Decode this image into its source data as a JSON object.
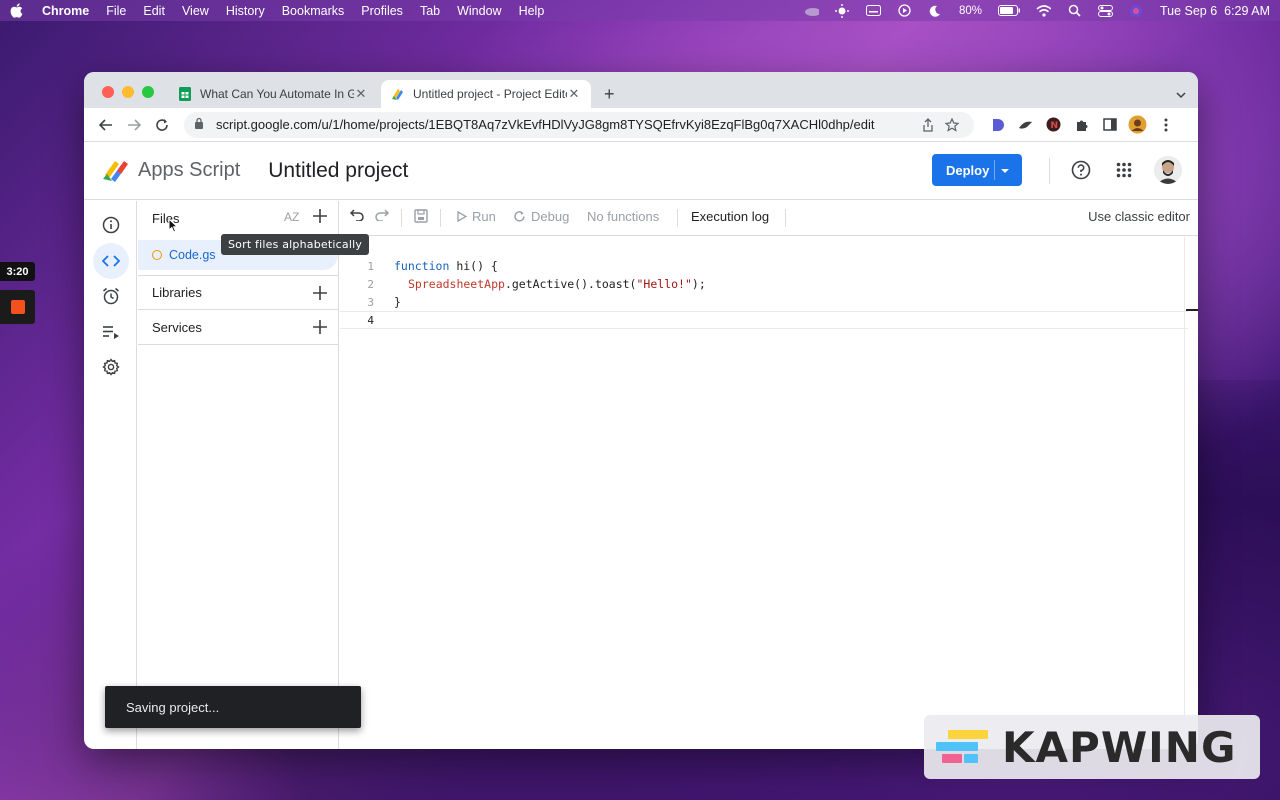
{
  "menubar": {
    "app": "Chrome",
    "items": [
      "File",
      "Edit",
      "View",
      "History",
      "Bookmarks",
      "Profiles",
      "Tab",
      "Window",
      "Help"
    ],
    "battery": "80%",
    "datetime": "Tue Sep 6  6:29 AM"
  },
  "browser": {
    "tabs": [
      {
        "title": "What Can You Automate In Goo",
        "active": false
      },
      {
        "title": "Untitled project - Project Editor",
        "active": true
      }
    ],
    "url": "script.google.com/u/1/home/projects/1EBQT8Aq7zVkEvfHDlVyJG8gm8TYSQEfrvKyi8EzqFlBg0q7XACHl0dhp/edit"
  },
  "header": {
    "brand": "Apps Script",
    "project_name": "Untitled project",
    "deploy_label": "Deploy"
  },
  "files_panel": {
    "title": "Files",
    "sort_label": "AZ",
    "files": [
      {
        "name": "Code.gs"
      }
    ],
    "sections": [
      {
        "label": "Libraries"
      },
      {
        "label": "Services"
      }
    ],
    "tooltip": "Sort files alphabetically"
  },
  "editor_toolbar": {
    "run_label": "Run",
    "debug_label": "Debug",
    "function_select": "No functions",
    "execution_log_label": "Execution log",
    "classic_editor_label": "Use classic editor"
  },
  "code": {
    "line_numbers": [
      "1",
      "2",
      "3",
      "4"
    ],
    "lines": [
      {
        "kw": "function",
        "rest": " hi() {"
      },
      {
        "cls": "SpreadsheetApp",
        "mid": ".getActive().toast(",
        "str": "\"Hello!\"",
        "end": ");"
      },
      {
        "text": "}"
      },
      {
        "text": ""
      }
    ]
  },
  "snackbar": "Saving project...",
  "overlay": {
    "recording_time": "3:20",
    "watermark": "KAPWING"
  },
  "colors": {
    "accent": "#1a73e8",
    "keyword": "#1a62b8",
    "class": "#c0392b",
    "string": "#a31515",
    "file_dot": "#f29900"
  }
}
